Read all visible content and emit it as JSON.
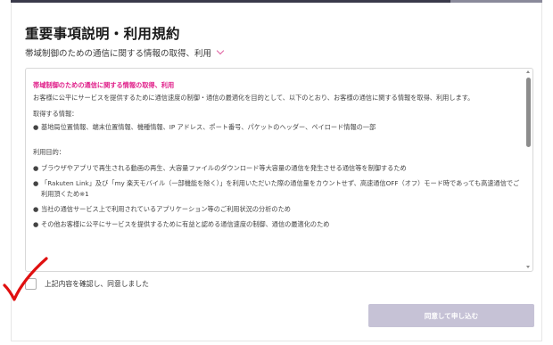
{
  "dialog": {
    "title": "重要事項説明・利用規約",
    "subtitle": "帯域制御のための通信に関する情報の取得、利用",
    "section_title": "帯域制御のための通信に関する情報の取得、利用",
    "intro": "お客様に公平にサービスを提供するために通信速度の制御・通信の最適化を目的として、以下のとおり、お客様の通信に関する情報を取得、利用します。",
    "acquire_label": "取得する情報：",
    "acquire_bullets": [
      "基地局位置情報、端末位置情報、機種情報、IP アドレス、ポート番号、パケットのヘッダー、ペイロード情報の一部"
    ],
    "purpose_label": "利用目的：",
    "purpose_bullets": [
      "ブラウザやアプリで再生される動画の再生、大容量ファイルのダウンロード等大容量の通信を発生させる通信等を制御するため",
      "「Rakuten Link」及び「my 楽天モバイル（一部機能を除く）」を利用いただいた際の通信量をカウントせず、高速通信OFF（オフ）モード時であっても高速通信でご利用頂くため※1",
      "当社の通信サービス上で利用されているアプリケーション等のご利用状況の分析のため",
      "その他お客様に公平にサービスを提供するために有益と認める通信速度の制御、通信の最適化のため"
    ],
    "bullet_glyph": "●",
    "agree_label": "上記内容を確認し、同意しました",
    "agree_checked": false,
    "submit_label": "同意して申し込む",
    "accent_color": "#e0208a",
    "submit_color": "#c6c2d6",
    "annotation_color": "#e01010"
  }
}
